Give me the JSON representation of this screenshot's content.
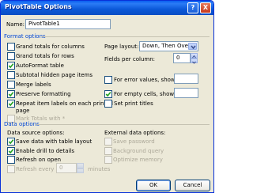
{
  "dialog": {
    "title": "PivotTable Options",
    "help_glyph": "?",
    "close_glyph": "X"
  },
  "name_field": {
    "label": "Name:",
    "value": "PivotTable1"
  },
  "format_options": {
    "header": "Format options",
    "left": [
      {
        "label": "Grand totals for columns",
        "checked": false,
        "disabled": false
      },
      {
        "label": "Grand totals for rows",
        "checked": false,
        "disabled": false
      },
      {
        "label": "AutoFormat table",
        "checked": true,
        "disabled": false
      },
      {
        "label": "Subtotal hidden page items",
        "checked": false,
        "disabled": false
      },
      {
        "label": "Merge labels",
        "checked": false,
        "disabled": false
      },
      {
        "label": "Preserve formatting",
        "checked": true,
        "disabled": false
      },
      {
        "label": "Repeat item labels on each printed",
        "label2": "page",
        "checked": true,
        "disabled": false
      },
      {
        "label": "Mark Totals with *",
        "checked": false,
        "disabled": true
      }
    ],
    "page_layout": {
      "label": "Page layout:",
      "value": "Down, Then Over"
    },
    "fields_per_column": {
      "label": "Fields per column:",
      "value": "0"
    },
    "error_values": {
      "label": "For error values, show:",
      "checked": false,
      "value": ""
    },
    "empty_cells": {
      "label": "For empty cells, show:",
      "checked": true,
      "value": ""
    },
    "set_print_titles": {
      "label": "Set print titles",
      "checked": false
    }
  },
  "data_options": {
    "header": "Data options",
    "source_header": "Data source options:",
    "source": [
      {
        "label": "Save data with table layout",
        "checked": true,
        "disabled": false
      },
      {
        "label": "Enable drill to details",
        "checked": true,
        "disabled": false
      },
      {
        "label": "Refresh on open",
        "checked": false,
        "disabled": false
      }
    ],
    "refresh_every": {
      "label": "Refresh every",
      "value": "0",
      "unit": "minutes",
      "disabled": true
    },
    "external_header": "External data options:",
    "external": [
      {
        "label": "Save password",
        "checked": false,
        "disabled": true
      },
      {
        "label": "Background query",
        "checked": false,
        "disabled": true
      },
      {
        "label": "Optimize memory",
        "checked": false,
        "disabled": true
      }
    ]
  },
  "buttons": {
    "ok": "OK",
    "cancel": "Cancel"
  }
}
